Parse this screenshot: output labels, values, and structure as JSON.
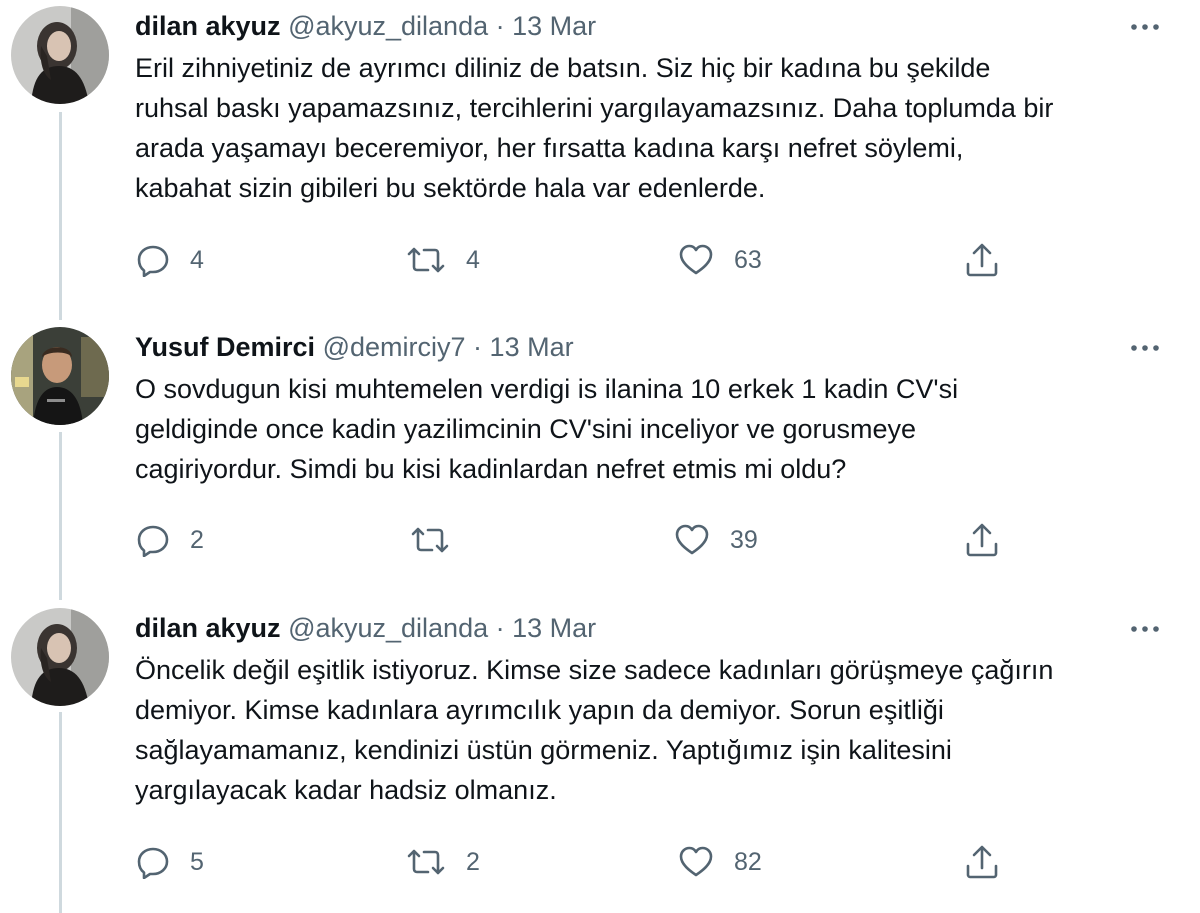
{
  "colors": {
    "text": "#0f1419",
    "secondary": "#536471",
    "thread_line": "#cfd9de",
    "background": "#ffffff"
  },
  "tweets": [
    {
      "name": "dilan akyuz",
      "handle": "@akyuz_dilanda",
      "separator": "·",
      "date": "13 Mar",
      "text_lines": [
        "Eril zihniyetiniz de ayrımcı diliniz de batsın. Siz hiç bir kadına bu şekilde",
        "ruhsal baskı yapamazsınız, tercihlerini yargılayamazsınız. Daha toplumda bir",
        "arada yaşamayı beceremiyor, her fırsatta kadına karşı nefret söylemi,",
        "kabahat sizin gibileri bu sektörde hala var edenlerde."
      ],
      "replies": "4",
      "retweets": "4",
      "likes": "63",
      "icons": [
        "reply-icon",
        "retweet-icon",
        "like-icon",
        "share-icon",
        "more-icon"
      ]
    },
    {
      "name": "Yusuf Demirci",
      "handle": "@demirciy7",
      "separator": "·",
      "date": "13 Mar",
      "text_lines": [
        "O sovdugun kisi muhtemelen verdigi is ilanina 10 erkek 1 kadin CV'si",
        "geldiginde once kadin yazilimcinin CV'sini inceliyor ve gorusmeye",
        "cagiriyordur. Simdi bu kisi kadinlardan nefret etmis mi oldu?"
      ],
      "replies": "2",
      "retweets": "",
      "likes": "39",
      "icons": [
        "reply-icon",
        "retweet-icon",
        "like-icon",
        "share-icon",
        "more-icon"
      ]
    },
    {
      "name": "dilan akyuz",
      "handle": "@akyuz_dilanda",
      "separator": "·",
      "date": "13 Mar",
      "text_lines": [
        "Öncelik değil eşitlik istiyoruz. Kimse size sadece kadınları görüşmeye çağırın",
        "demiyor. Kimse kadınlara ayrımcılık yapın da demiyor. Sorun eşitliği",
        "sağlayamamanız, kendinizi üstün görmeniz. Yaptığımız işin kalitesini",
        "yargılayacak kadar hadsiz olmanız."
      ],
      "replies": "5",
      "retweets": "2",
      "likes": "82",
      "icons": [
        "reply-icon",
        "retweet-icon",
        "like-icon",
        "share-icon",
        "more-icon"
      ]
    }
  ]
}
